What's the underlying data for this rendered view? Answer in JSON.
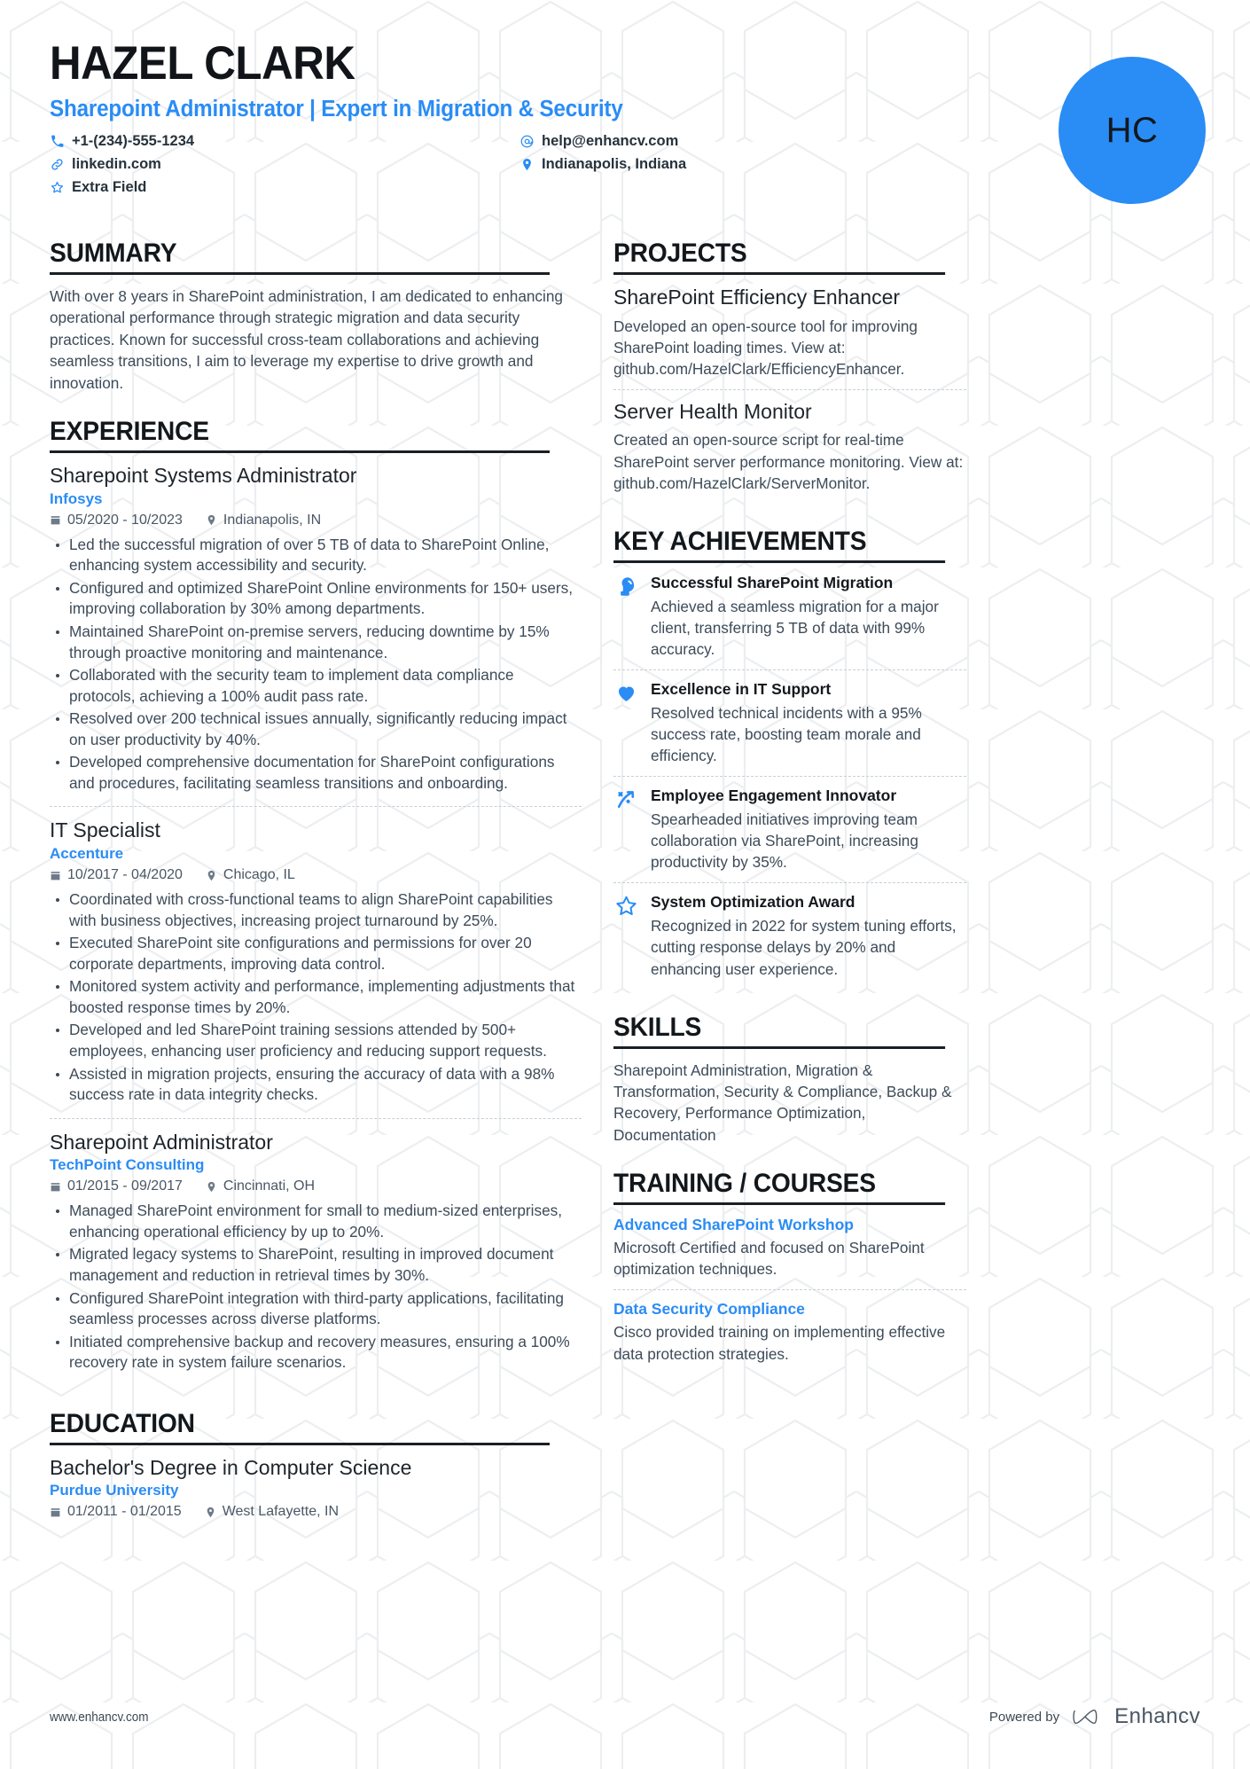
{
  "header": {
    "name": "HAZEL CLARK",
    "headline": "Sharepoint Administrator | Expert in Migration & Security",
    "avatar_initials": "HC",
    "accent_color": "#2a8cf5",
    "contacts": [
      {
        "icon": "phone-icon",
        "text": "+1-(234)-555-1234"
      },
      {
        "icon": "email-icon",
        "text": "help@enhancv.com"
      },
      {
        "icon": "link-icon",
        "text": "linkedin.com"
      },
      {
        "icon": "location-icon",
        "text": "Indianapolis, Indiana"
      },
      {
        "icon": "star-icon",
        "text": "Extra Field"
      }
    ]
  },
  "summary": {
    "title": "SUMMARY",
    "text": "With over 8 years in SharePoint administration, I am dedicated to enhancing operational performance through strategic migration and data security practices. Known for successful cross-team collaborations and achieving seamless transitions, I aim to leverage my expertise to drive growth and innovation."
  },
  "experience": {
    "title": "EXPERIENCE",
    "entries": [
      {
        "role": "Sharepoint Systems Administrator",
        "company": "Infosys",
        "dates": "05/2020 - 10/2023",
        "location": "Indianapolis, IN",
        "bullets": [
          "Led the successful migration of over 5 TB of data to SharePoint Online, enhancing system accessibility and security.",
          "Configured and optimized SharePoint Online environments for 150+ users, improving collaboration by 30% among departments.",
          "Maintained SharePoint on-premise servers, reducing downtime by 15% through proactive monitoring and maintenance.",
          "Collaborated with the security team to implement data compliance protocols, achieving a 100% audit pass rate.",
          "Resolved over 200 technical issues annually, significantly reducing impact on user productivity by 40%.",
          "Developed comprehensive documentation for SharePoint configurations and procedures, facilitating seamless transitions and onboarding."
        ]
      },
      {
        "role": "IT Specialist",
        "company": "Accenture",
        "dates": "10/2017 - 04/2020",
        "location": "Chicago, IL",
        "bullets": [
          "Coordinated with cross-functional teams to align SharePoint capabilities with business objectives, increasing project turnaround by 25%.",
          "Executed SharePoint site configurations and permissions for over 20 corporate departments, improving data control.",
          "Monitored system activity and performance, implementing adjustments that boosted response times by 20%.",
          "Developed and led SharePoint training sessions attended by 500+ employees, enhancing user proficiency and reducing support requests.",
          "Assisted in migration projects, ensuring the accuracy of data with a 98% success rate in data integrity checks."
        ]
      },
      {
        "role": "Sharepoint Administrator",
        "company": "TechPoint Consulting",
        "dates": "01/2015 - 09/2017",
        "location": "Cincinnati, OH",
        "bullets": [
          "Managed SharePoint environment for small to medium-sized enterprises, enhancing operational efficiency by up to 20%.",
          "Migrated legacy systems to SharePoint, resulting in improved document management and reduction in retrieval times by 30%.",
          "Configured SharePoint integration with third-party applications, facilitating seamless processes across diverse platforms.",
          "Initiated comprehensive backup and recovery measures, ensuring a 100% recovery rate in system failure scenarios."
        ]
      }
    ]
  },
  "education": {
    "title": "EDUCATION",
    "entries": [
      {
        "degree": "Bachelor's Degree in Computer Science",
        "school": "Purdue University",
        "dates": "01/2011 - 01/2015",
        "location": "West Lafayette, IN"
      }
    ]
  },
  "projects": {
    "title": "PROJECTS",
    "entries": [
      {
        "name": "SharePoint Efficiency Enhancer",
        "description": "Developed an open-source tool for improving SharePoint loading times. View at: github.com/HazelClark/EfficiencyEnhancer."
      },
      {
        "name": "Server Health Monitor",
        "description": "Created an open-source script for real-time SharePoint server performance monitoring. View at: github.com/HazelClark/ServerMonitor."
      }
    ]
  },
  "key_achievements": {
    "title": "KEY ACHIEVEMENTS",
    "entries": [
      {
        "icon": "head-thought-icon",
        "title": "Successful SharePoint Migration",
        "description": "Achieved a seamless migration for a major client, transferring 5 TB of data with 99% accuracy."
      },
      {
        "icon": "heart-icon",
        "title": "Excellence in IT Support",
        "description": "Resolved technical incidents with a 95% success rate, boosting team morale and efficiency."
      },
      {
        "icon": "trend-arrow-icon",
        "title": "Employee Engagement Innovator",
        "description": "Spearheaded initiatives improving team collaboration via SharePoint, increasing productivity by 35%."
      },
      {
        "icon": "star-outline-icon",
        "title": "System Optimization Award",
        "description": "Recognized in 2022 for system tuning efforts, cutting response delays by 20% and enhancing user experience."
      }
    ]
  },
  "skills": {
    "title": "SKILLS",
    "text": "Sharepoint Administration, Migration & Transformation, Security & Compliance, Backup & Recovery, Performance Optimization, Documentation"
  },
  "training": {
    "title": "TRAINING / COURSES",
    "entries": [
      {
        "name": "Advanced SharePoint Workshop",
        "description": "Microsoft Certified and focused on SharePoint optimization techniques."
      },
      {
        "name": "Data Security Compliance",
        "description": "Cisco provided training on implementing effective data protection strategies."
      }
    ]
  },
  "footer": {
    "website": "www.enhancv.com",
    "powered_by": "Powered by",
    "brand": "Enhancv"
  }
}
